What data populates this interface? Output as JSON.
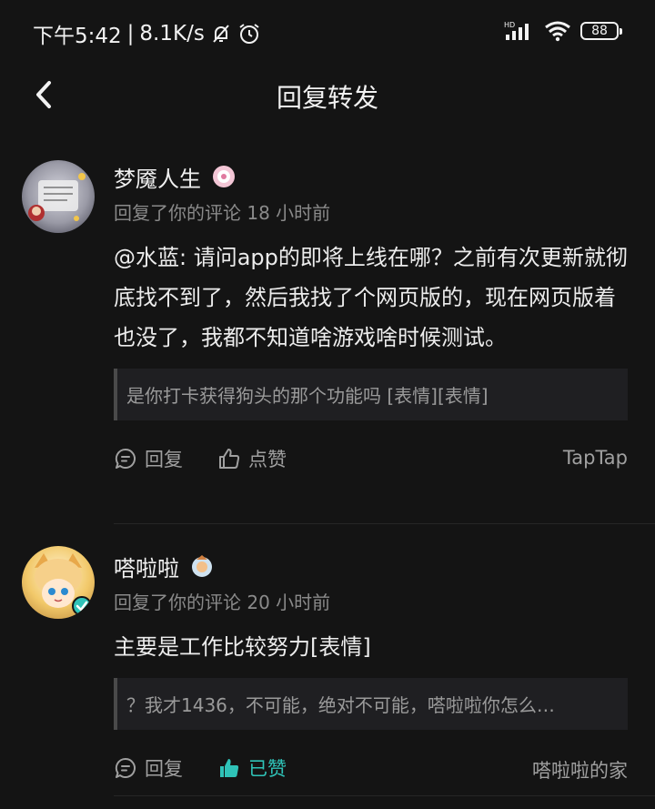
{
  "status_bar": {
    "time": "下午5:42",
    "separator": "|",
    "net_speed": "8.1K/s",
    "battery": "88"
  },
  "header": {
    "title": "回复转发"
  },
  "notifications": [
    {
      "user_name": "梦魇人生",
      "meta": "回复了你的评论 18 小时前",
      "body": "@水蓝: 请问app的即将上线在哪？之前有次更新就彻底找不到了，然后我找了个网页版的，现在网页版着也没了，我都不知道啥游戏啥时候测试。",
      "quote": "是你打卡获得狗头的那个功能吗 [表情][表情]",
      "reply_label": "回复",
      "like_label": "点赞",
      "liked": false,
      "source": "TapTap"
    },
    {
      "user_name": "嗒啦啦",
      "meta": "回复了你的评论 20 小时前",
      "body": "主要是工作比较努力[表情]",
      "quote": "？我才1436，不可能，绝对不可能，嗒啦啦你怎么…",
      "reply_label": "回复",
      "like_label": "已赞",
      "liked": true,
      "source": "嗒啦啦的家"
    }
  ],
  "colors": {
    "background": "#141414",
    "accent_liked": "#2fc3b8",
    "muted_text": "#8a8a8a"
  }
}
